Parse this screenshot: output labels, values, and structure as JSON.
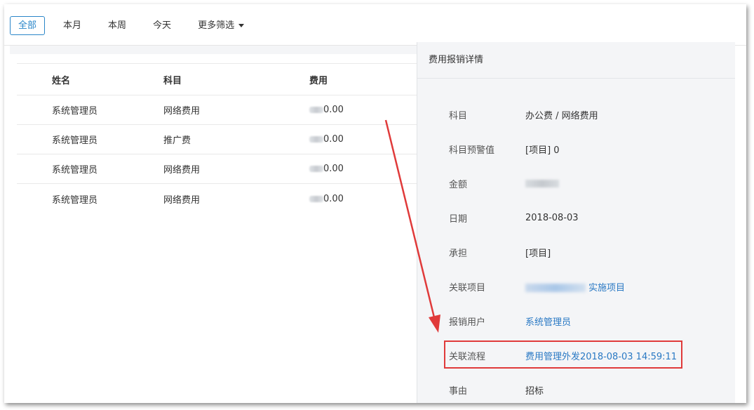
{
  "filters": {
    "tabs": [
      {
        "label": "全部",
        "active": true
      },
      {
        "label": "本月",
        "active": false
      },
      {
        "label": "本周",
        "active": false
      },
      {
        "label": "今天",
        "active": false
      }
    ],
    "more_label": "更多筛选"
  },
  "table": {
    "headers": [
      "姓名",
      "科目",
      "费用"
    ],
    "rows": [
      {
        "name": "系统管理员",
        "subject": "网络费用",
        "cost_suffix": "0.00"
      },
      {
        "name": "系统管理员",
        "subject": "推广费",
        "cost_suffix": "0.00"
      },
      {
        "name": "系统管理员",
        "subject": "网络费用",
        "cost_suffix": "0.00"
      },
      {
        "name": "系统管理员",
        "subject": "网络费用",
        "cost_suffix": "0.00"
      }
    ]
  },
  "detail": {
    "title": "费用报销详情",
    "fields": [
      {
        "label": "科目",
        "value": "办公费 / 网络费用",
        "type": "text"
      },
      {
        "label": "科目预警值",
        "value": "[项目] 0",
        "type": "text"
      },
      {
        "label": "金额",
        "value": "",
        "type": "blurred"
      },
      {
        "label": "日期",
        "value": "2018-08-03",
        "type": "text"
      },
      {
        "label": "承担",
        "value": "[项目]",
        "type": "text"
      },
      {
        "label": "关联项目",
        "value": "实施项目",
        "type": "link-blurred"
      },
      {
        "label": "报销用户",
        "value": "系统管理员",
        "type": "link"
      },
      {
        "label": "关联流程",
        "value": "费用管理外发2018-08-03 14:59:11",
        "type": "link"
      },
      {
        "label": "事由",
        "value": "招标",
        "type": "text"
      }
    ]
  },
  "colors": {
    "accent": "#2a86c9",
    "link": "#2a79c4",
    "highlight": "#e03a3a",
    "panel_bg": "#f4f5f7"
  }
}
